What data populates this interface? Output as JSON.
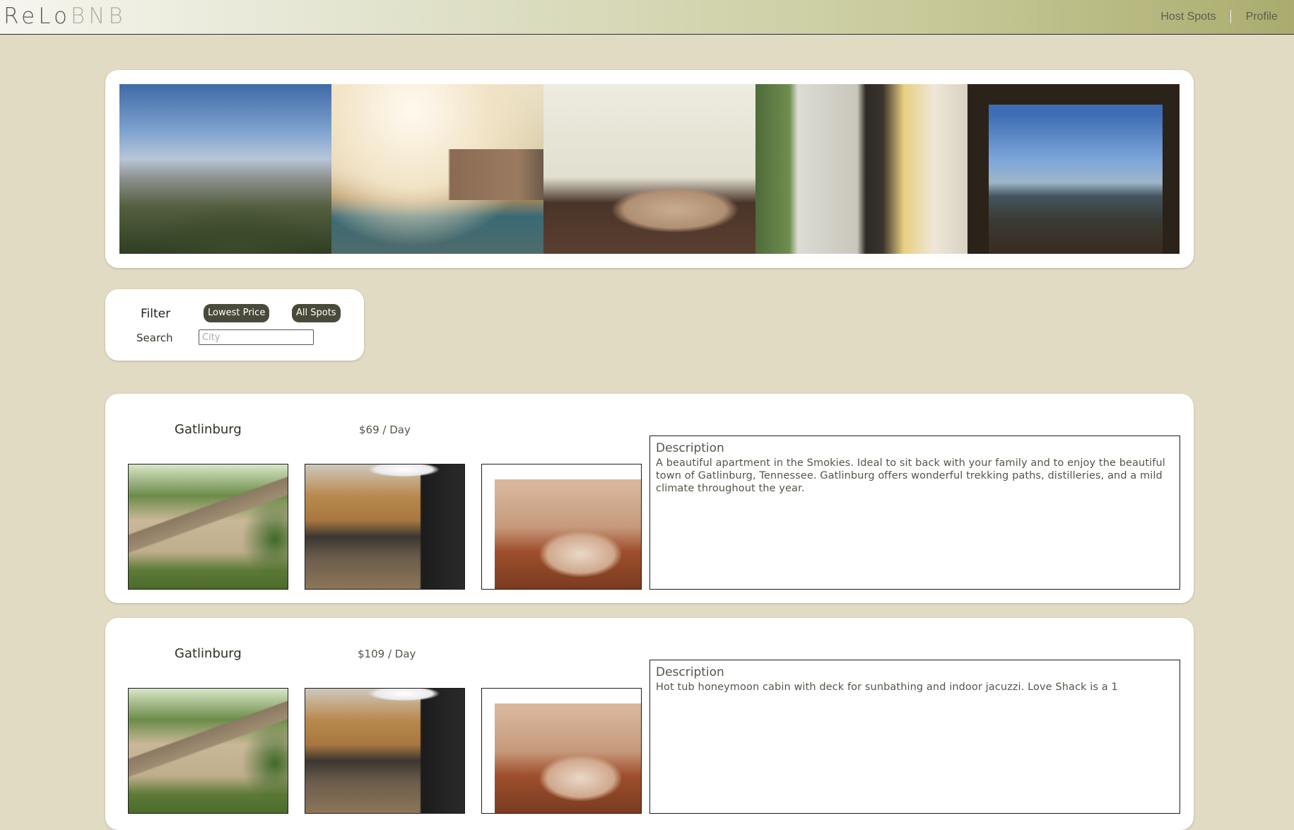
{
  "header": {
    "logo_part1": "ReLo",
    "logo_part2": "BNB",
    "nav": {
      "host_spots": "Host Spots",
      "profile": "Profile"
    }
  },
  "filter": {
    "title": "Filter",
    "lowest_price_button": "Lowest Price",
    "all_spots_button": "All Spots",
    "search_label": "Search",
    "city_placeholder": "City",
    "city_value": ""
  },
  "listings": [
    {
      "city": "Gatlinburg",
      "price": "$69 / Day",
      "description_title": "Description",
      "description": "A beautiful apartment in the Smokies. Ideal to sit back with your family and to enjoy the beautiful town of Gatlinburg, Tennessee. Gatlinburg offers wonderful trekking paths, distilleries, and a mild climate throughout the year."
    },
    {
      "city": "Gatlinburg",
      "price": "$109 / Day",
      "description_title": "Description",
      "description": "Hot tub honeymoon cabin with deck for sunbathing and indoor jacuzzi. Love Shack is a 1"
    }
  ],
  "colors": {
    "page_background": "#e2dbc3",
    "button_background": "#4a4a3a",
    "header_gradient_end": "#aaac6e"
  }
}
